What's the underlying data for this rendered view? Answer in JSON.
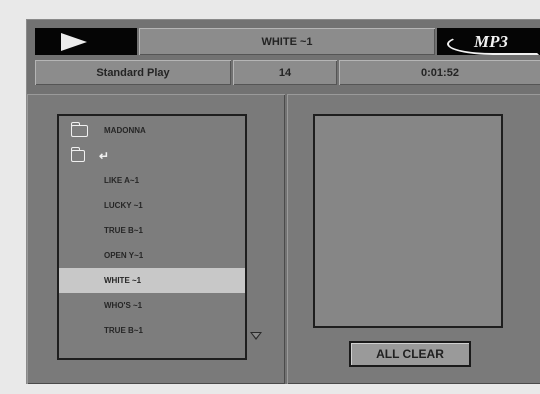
{
  "header": {
    "track_title": "WHITE ~1",
    "logo": "MP3",
    "play_mode": "Standard Play",
    "track_number": "14",
    "elapsed_time": "0:01:52"
  },
  "file_list": {
    "folder_name": "MADONNA",
    "up_symbol": "↵",
    "items": [
      "LIKE A~1",
      "LUCKY ~1",
      "TRUE B~1",
      "OPEN Y~1",
      "WHITE ~1",
      "WHO'S ~1",
      "TRUE B~1"
    ],
    "selected_index": 4
  },
  "program": {
    "clear_label": "ALL CLEAR"
  }
}
